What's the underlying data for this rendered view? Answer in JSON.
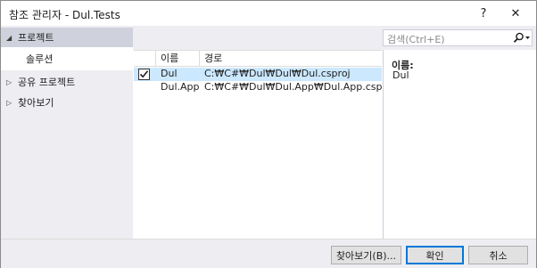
{
  "window": {
    "title": "참조 관리자 - Dul.Tests",
    "help_label": "?",
    "close_label": "✕"
  },
  "sidebar": {
    "items": [
      {
        "label": "프로젝트",
        "expander": "◢",
        "selected": true
      },
      {
        "label": "솔루션",
        "expander": "",
        "active": true
      },
      {
        "label": "공유 프로젝트",
        "expander": "▷"
      },
      {
        "label": "찾아보기",
        "expander": "▷"
      }
    ]
  },
  "search": {
    "placeholder": "검색(Ctrl+E)",
    "icon": "search-icon"
  },
  "grid": {
    "columns": [
      "",
      "이름",
      "경로"
    ],
    "rows": [
      {
        "checked": true,
        "name": "Dul",
        "path": "C:₩C#₩Dul₩Dul₩Dul.csproj"
      },
      {
        "checked": false,
        "name": "Dul.App",
        "path": "C:₩C#₩Dul₩Dul.App₩Dul.App.csproj"
      }
    ]
  },
  "details": {
    "name_label": "이름:",
    "name_value": "Dul"
  },
  "footer": {
    "browse_label": "찾아보기(B)...",
    "ok_label": "확인",
    "cancel_label": "취소"
  },
  "colors": {
    "selection": "#cce8ff",
    "nav_selected": "#cfd2dc",
    "panel": "#eeeef2",
    "focus_border": "#0078d7"
  }
}
